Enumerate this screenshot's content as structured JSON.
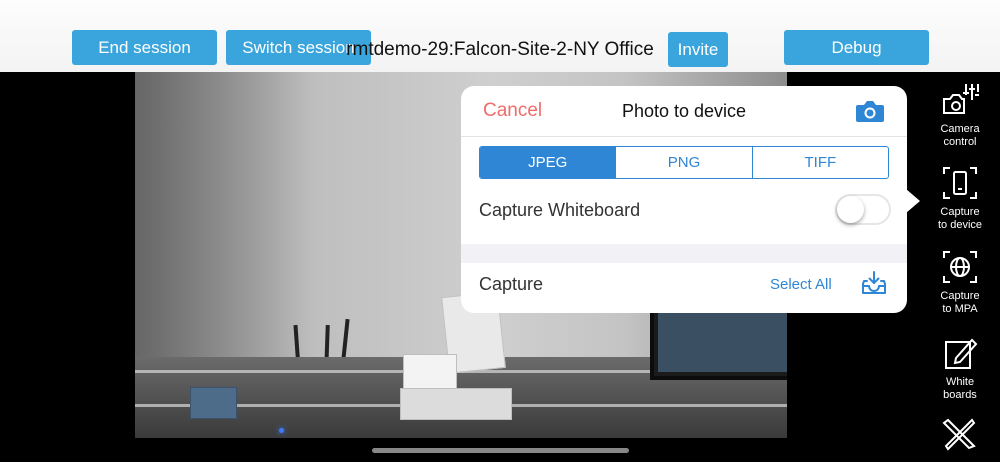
{
  "topbar": {
    "end_session": "End session",
    "switch_session": "Switch session",
    "title": "rmtdemo-29:Falcon-Site-2-NY Office",
    "invite": "Invite",
    "debug": "Debug"
  },
  "popup": {
    "cancel": "Cancel",
    "title": "Photo to device",
    "formats": [
      "JPEG",
      "PNG",
      "TIFF"
    ],
    "selected_format": "JPEG",
    "capture_whiteboard_label": "Capture Whiteboard",
    "capture_whiteboard_on": false,
    "capture_label": "Capture",
    "select_all": "Select All"
  },
  "sidebar": {
    "items": [
      {
        "line1": "Camera",
        "line2": "control",
        "icon": "camera-control-icon"
      },
      {
        "line1": "Capture",
        "line2": "to device",
        "icon": "capture-device-icon"
      },
      {
        "line1": "Capture",
        "line2": "to MPA",
        "icon": "capture-mpa-icon"
      },
      {
        "line1": "White",
        "line2": "boards",
        "icon": "whiteboard-icon"
      },
      {
        "line1": "",
        "line2": "",
        "icon": "pencil-ruler-icon"
      }
    ]
  },
  "colors": {
    "accent": "#2f86d5",
    "button": "#3aa5dc",
    "cancel": "#f06c6c"
  }
}
